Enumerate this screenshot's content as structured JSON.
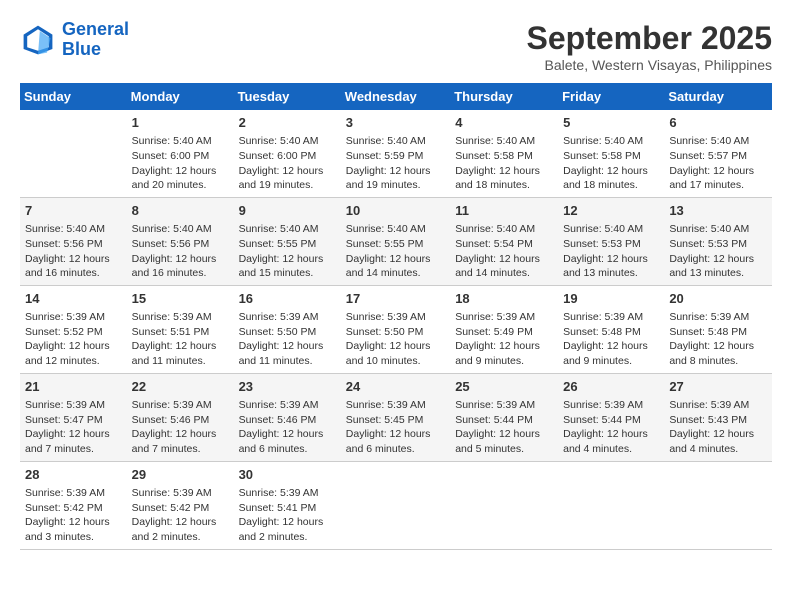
{
  "header": {
    "logo_line1": "General",
    "logo_line2": "Blue",
    "month": "September 2025",
    "location": "Balete, Western Visayas, Philippines"
  },
  "weekdays": [
    "Sunday",
    "Monday",
    "Tuesday",
    "Wednesday",
    "Thursday",
    "Friday",
    "Saturday"
  ],
  "weeks": [
    [
      {
        "day": "",
        "info": ""
      },
      {
        "day": "1",
        "info": "Sunrise: 5:40 AM\nSunset: 6:00 PM\nDaylight: 12 hours\nand 20 minutes."
      },
      {
        "day": "2",
        "info": "Sunrise: 5:40 AM\nSunset: 6:00 PM\nDaylight: 12 hours\nand 19 minutes."
      },
      {
        "day": "3",
        "info": "Sunrise: 5:40 AM\nSunset: 5:59 PM\nDaylight: 12 hours\nand 19 minutes."
      },
      {
        "day": "4",
        "info": "Sunrise: 5:40 AM\nSunset: 5:58 PM\nDaylight: 12 hours\nand 18 minutes."
      },
      {
        "day": "5",
        "info": "Sunrise: 5:40 AM\nSunset: 5:58 PM\nDaylight: 12 hours\nand 18 minutes."
      },
      {
        "day": "6",
        "info": "Sunrise: 5:40 AM\nSunset: 5:57 PM\nDaylight: 12 hours\nand 17 minutes."
      }
    ],
    [
      {
        "day": "7",
        "info": "Sunrise: 5:40 AM\nSunset: 5:56 PM\nDaylight: 12 hours\nand 16 minutes."
      },
      {
        "day": "8",
        "info": "Sunrise: 5:40 AM\nSunset: 5:56 PM\nDaylight: 12 hours\nand 16 minutes."
      },
      {
        "day": "9",
        "info": "Sunrise: 5:40 AM\nSunset: 5:55 PM\nDaylight: 12 hours\nand 15 minutes."
      },
      {
        "day": "10",
        "info": "Sunrise: 5:40 AM\nSunset: 5:55 PM\nDaylight: 12 hours\nand 14 minutes."
      },
      {
        "day": "11",
        "info": "Sunrise: 5:40 AM\nSunset: 5:54 PM\nDaylight: 12 hours\nand 14 minutes."
      },
      {
        "day": "12",
        "info": "Sunrise: 5:40 AM\nSunset: 5:53 PM\nDaylight: 12 hours\nand 13 minutes."
      },
      {
        "day": "13",
        "info": "Sunrise: 5:40 AM\nSunset: 5:53 PM\nDaylight: 12 hours\nand 13 minutes."
      }
    ],
    [
      {
        "day": "14",
        "info": "Sunrise: 5:39 AM\nSunset: 5:52 PM\nDaylight: 12 hours\nand 12 minutes."
      },
      {
        "day": "15",
        "info": "Sunrise: 5:39 AM\nSunset: 5:51 PM\nDaylight: 12 hours\nand 11 minutes."
      },
      {
        "day": "16",
        "info": "Sunrise: 5:39 AM\nSunset: 5:50 PM\nDaylight: 12 hours\nand 11 minutes."
      },
      {
        "day": "17",
        "info": "Sunrise: 5:39 AM\nSunset: 5:50 PM\nDaylight: 12 hours\nand 10 minutes."
      },
      {
        "day": "18",
        "info": "Sunrise: 5:39 AM\nSunset: 5:49 PM\nDaylight: 12 hours\nand 9 minutes."
      },
      {
        "day": "19",
        "info": "Sunrise: 5:39 AM\nSunset: 5:48 PM\nDaylight: 12 hours\nand 9 minutes."
      },
      {
        "day": "20",
        "info": "Sunrise: 5:39 AM\nSunset: 5:48 PM\nDaylight: 12 hours\nand 8 minutes."
      }
    ],
    [
      {
        "day": "21",
        "info": "Sunrise: 5:39 AM\nSunset: 5:47 PM\nDaylight: 12 hours\nand 7 minutes."
      },
      {
        "day": "22",
        "info": "Sunrise: 5:39 AM\nSunset: 5:46 PM\nDaylight: 12 hours\nand 7 minutes."
      },
      {
        "day": "23",
        "info": "Sunrise: 5:39 AM\nSunset: 5:46 PM\nDaylight: 12 hours\nand 6 minutes."
      },
      {
        "day": "24",
        "info": "Sunrise: 5:39 AM\nSunset: 5:45 PM\nDaylight: 12 hours\nand 6 minutes."
      },
      {
        "day": "25",
        "info": "Sunrise: 5:39 AM\nSunset: 5:44 PM\nDaylight: 12 hours\nand 5 minutes."
      },
      {
        "day": "26",
        "info": "Sunrise: 5:39 AM\nSunset: 5:44 PM\nDaylight: 12 hours\nand 4 minutes."
      },
      {
        "day": "27",
        "info": "Sunrise: 5:39 AM\nSunset: 5:43 PM\nDaylight: 12 hours\nand 4 minutes."
      }
    ],
    [
      {
        "day": "28",
        "info": "Sunrise: 5:39 AM\nSunset: 5:42 PM\nDaylight: 12 hours\nand 3 minutes."
      },
      {
        "day": "29",
        "info": "Sunrise: 5:39 AM\nSunset: 5:42 PM\nDaylight: 12 hours\nand 2 minutes."
      },
      {
        "day": "30",
        "info": "Sunrise: 5:39 AM\nSunset: 5:41 PM\nDaylight: 12 hours\nand 2 minutes."
      },
      {
        "day": "",
        "info": ""
      },
      {
        "day": "",
        "info": ""
      },
      {
        "day": "",
        "info": ""
      },
      {
        "day": "",
        "info": ""
      }
    ]
  ]
}
